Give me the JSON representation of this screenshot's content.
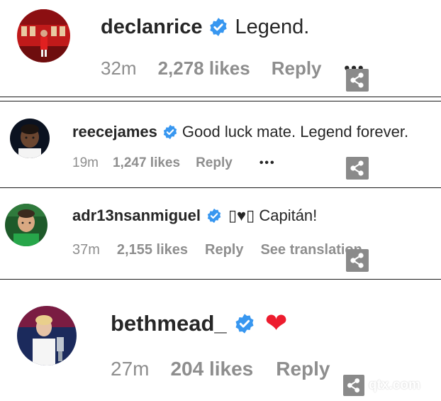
{
  "comments": [
    {
      "username": "declanrice",
      "verified": true,
      "text": "Legend.",
      "time": "32m",
      "likes": "2,278 likes",
      "reply": "Reply",
      "more": "•••",
      "avatar_icon": "avatar-declanrice"
    },
    {
      "username": "reecejames",
      "verified": true,
      "text": "Good luck mate. Legend forever.",
      "time": "19m",
      "likes": "1,247 likes",
      "reply": "Reply",
      "more": "•••",
      "avatar_icon": "avatar-reecejames"
    },
    {
      "username": "adr13nsanmiguel",
      "verified": true,
      "text": "▯♥▯ Capitán!",
      "time": "37m",
      "likes": "2,155 likes",
      "reply": "Reply",
      "see_translation": "See translation",
      "avatar_icon": "avatar-adr13nsanmiguel"
    },
    {
      "username": "bethmead_",
      "verified": true,
      "text": "❤",
      "time": "27m",
      "likes": "204 likes",
      "reply": "Reply",
      "avatar_icon": "avatar-bethmead"
    }
  ],
  "watermark": {
    "text": "qtx.com"
  },
  "colors": {
    "text": "#262626",
    "meta": "#8e8e8e",
    "verified": "#3897f0",
    "heart": "#ed1c2e",
    "share_bg": "#8a8a8a",
    "divider": "#1a1a1a"
  }
}
